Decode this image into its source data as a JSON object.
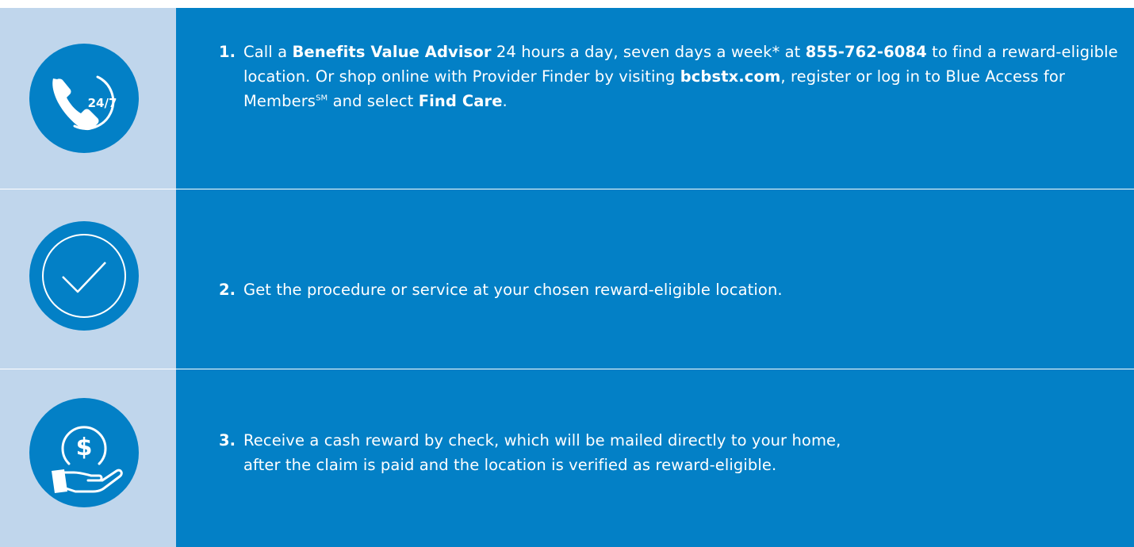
{
  "steps": [
    {
      "number": "1.",
      "icon": "phone-24-7-icon",
      "icon_label": "24/7",
      "parts": {
        "t1": "Call a ",
        "b1": "Benefits Value Advisor",
        "t2": " 24 hours a day, seven days a week* at ",
        "b2": "855-762-6084",
        "t3": " to find a reward-eligible location. Or shop online with Provider Finder by visiting ",
        "b3": "bcbstx.com",
        "t4": ", register or log in to Blue Access for Members",
        "sup": "SM",
        "t5": " and select ",
        "b4": "Find Care",
        "t6": "."
      }
    },
    {
      "number": "2.",
      "icon": "checkmark-icon",
      "text": "Get the procedure or service at your chosen reward-eligible location."
    },
    {
      "number": "3.",
      "icon": "cash-reward-hand-icon",
      "icon_label": "$",
      "line1": "Receive a cash reward by check, which will be mailed directly to your home,",
      "line2": "after the claim is paid and the location is verified as reward-eligible."
    }
  ],
  "colors": {
    "primary_blue": "#0380c6",
    "icon_panel": "#c0d6ec",
    "text": "#ffffff"
  }
}
